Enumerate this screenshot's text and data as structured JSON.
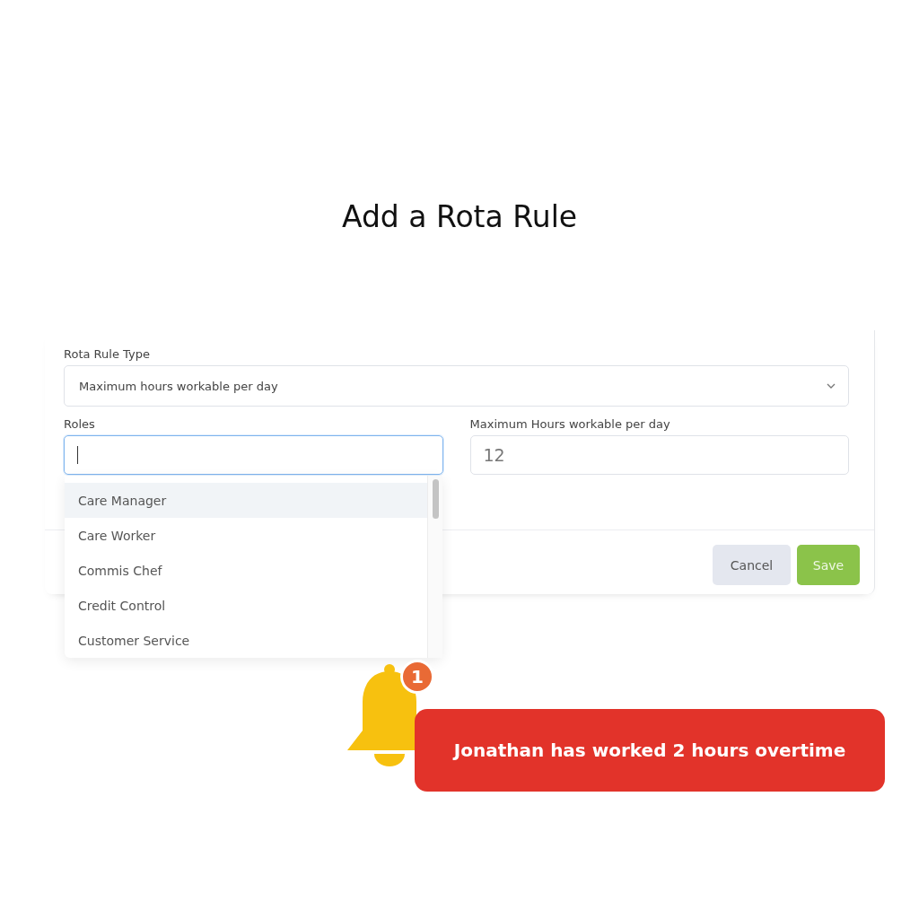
{
  "title": "Add a Rota Rule",
  "form": {
    "rule_type": {
      "label": "Rota Rule Type",
      "value": "Maximum hours workable per day"
    },
    "roles": {
      "label": "Roles"
    },
    "max_hours": {
      "label": "Maximum Hours workable per day",
      "value": "12"
    },
    "buttons": [
      {
        "kind": "secondary",
        "label": "Cancel"
      },
      {
        "kind": "primary",
        "label": "Save"
      }
    ]
  },
  "roles_dropdown": {
    "options": [
      {
        "label": "Care Manager",
        "selected": true
      },
      {
        "label": "Care Worker",
        "selected": false
      },
      {
        "label": "Commis Chef",
        "selected": false
      },
      {
        "label": "Credit Control",
        "selected": false
      },
      {
        "label": "Customer Service",
        "selected": false
      }
    ]
  },
  "notification": {
    "badge": "1",
    "message": "Jonathan has worked 2 hours overtime"
  }
}
